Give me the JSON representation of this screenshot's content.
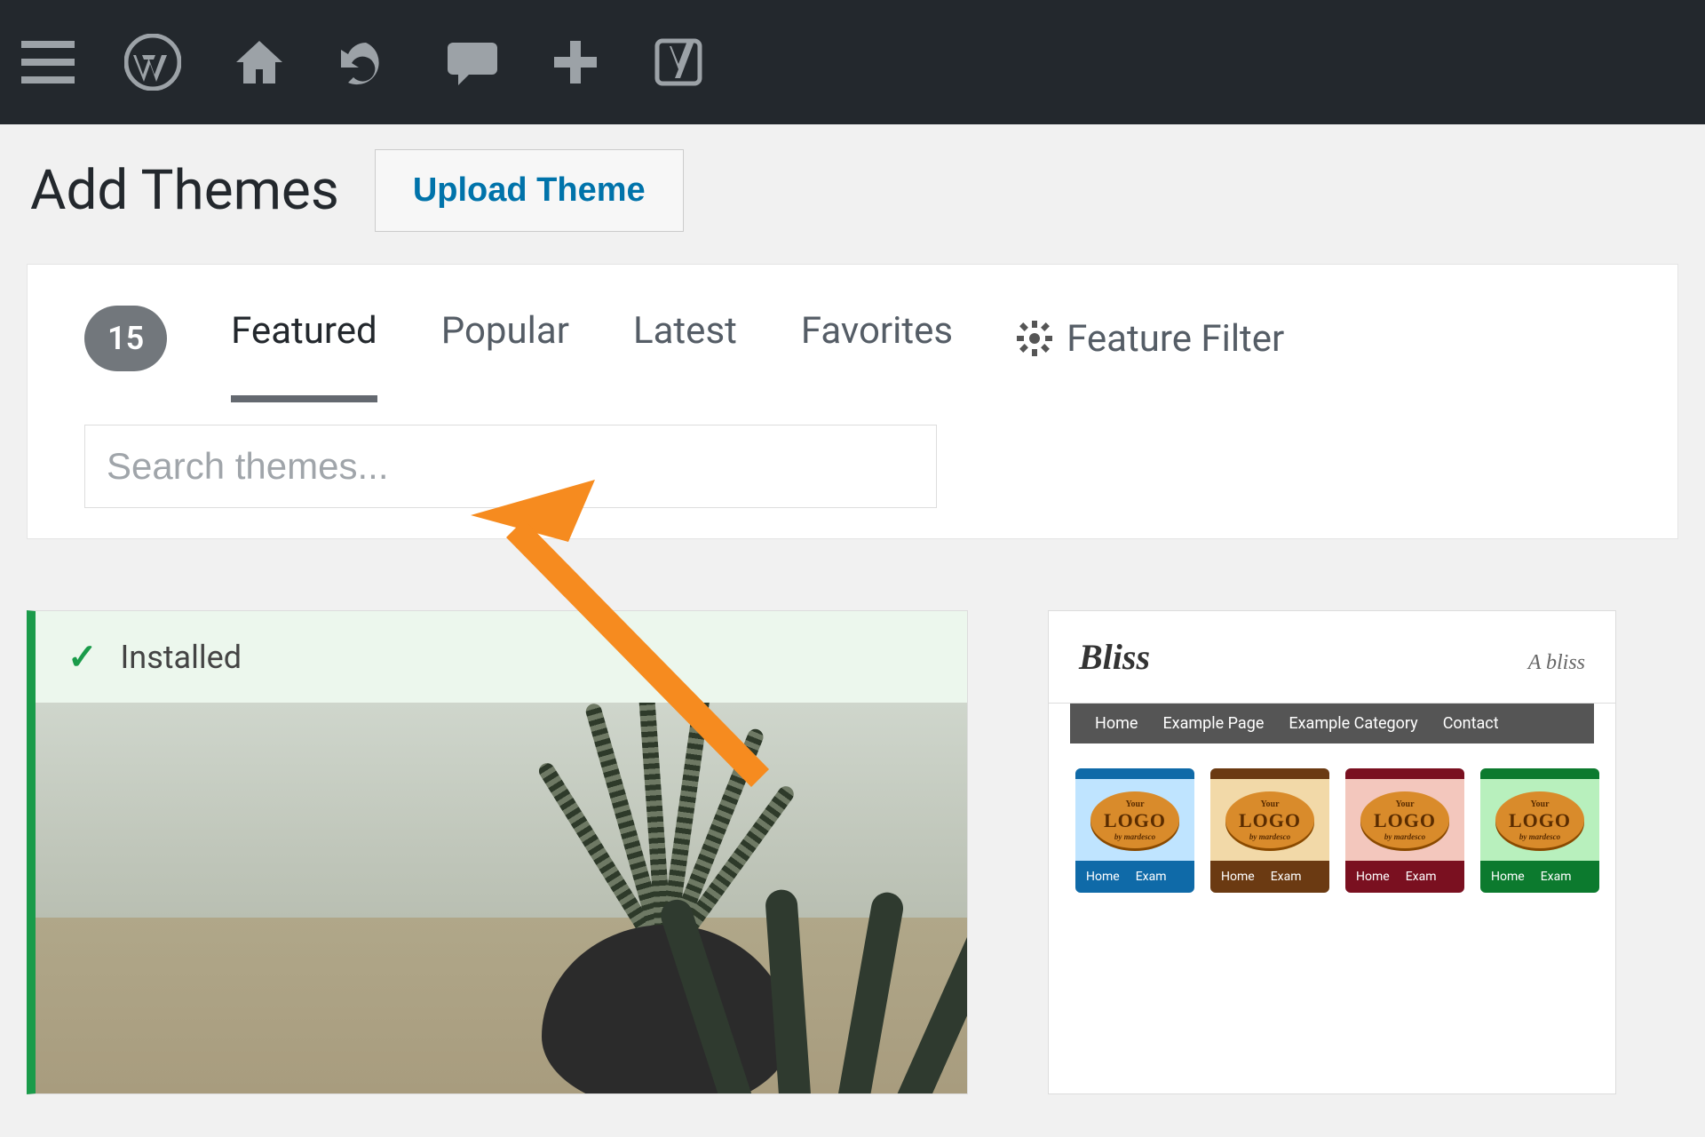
{
  "adminbar": {
    "icons": [
      "menu-icon",
      "wordpress-icon",
      "home-icon",
      "updates-icon",
      "comments-icon",
      "new-icon",
      "yoast-icon"
    ]
  },
  "header": {
    "title": "Add Themes",
    "upload_label": "Upload Theme"
  },
  "filter": {
    "count": "15",
    "tabs": [
      {
        "label": "Featured",
        "active": true
      },
      {
        "label": "Popular",
        "active": false
      },
      {
        "label": "Latest",
        "active": false
      },
      {
        "label": "Favorites",
        "active": false
      }
    ],
    "feature_filter_label": "Feature Filter"
  },
  "search": {
    "placeholder": "Search themes...",
    "value": ""
  },
  "themes": [
    {
      "installed": true,
      "installed_label": "Installed"
    },
    {
      "installed": false,
      "title": "Bliss",
      "tagline": "A bliss",
      "nav": [
        "Home",
        "Example Page",
        "Example Category",
        "Contact"
      ],
      "logo": {
        "top": "Your",
        "mid": "LOGO",
        "bot": "by mardesco"
      },
      "foot_items": [
        "Home",
        "Exam"
      ],
      "variants": [
        "blue",
        "brown",
        "maroon",
        "green"
      ]
    }
  ],
  "annotation": {
    "type": "arrow",
    "color": "#f68b1f"
  }
}
